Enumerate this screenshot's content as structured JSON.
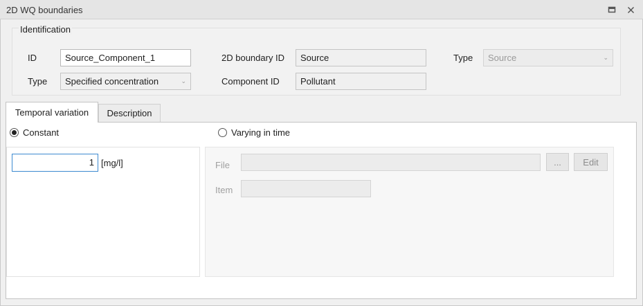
{
  "window": {
    "title": "2D WQ boundaries"
  },
  "identification": {
    "group_title": "Identification",
    "id_label": "ID",
    "id_value": "Source_Component_1",
    "type_label": "Type",
    "type_value": "Specified concentration",
    "boundary_id_label": "2D boundary ID",
    "boundary_id_value": "Source",
    "component_id_label": "Component ID",
    "component_id_value": "Pollutant",
    "boundary_type_label": "Type",
    "boundary_type_value": "Source"
  },
  "tabs": [
    {
      "label": "Temporal variation",
      "active": true
    },
    {
      "label": "Description",
      "active": false
    }
  ],
  "temporal": {
    "constant_label": "Constant",
    "varying_label": "Varying in time",
    "selected": "constant",
    "constant_value": "1",
    "unit": "[mg/l]",
    "file_label": "File",
    "file_value": "",
    "browse_label": "...",
    "edit_label": "Edit",
    "item_label": "Item",
    "item_value": ""
  },
  "icons": {
    "restore": "restore-icon",
    "close": "close-icon",
    "dropdown": "chevron-down-icon"
  }
}
